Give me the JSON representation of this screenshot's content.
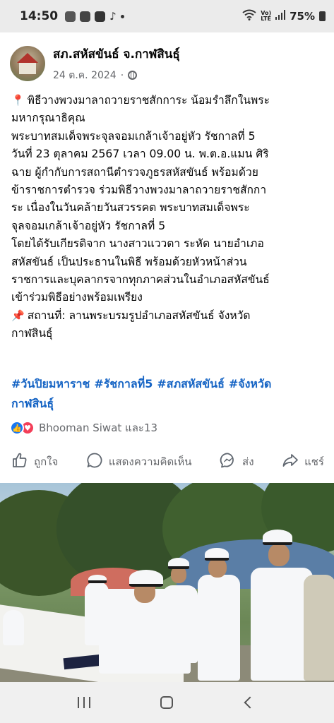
{
  "status_bar": {
    "time": "14:50",
    "left_icons": [
      "line-icon",
      "messages-icon",
      "checkbox-icon",
      "tiktok-icon",
      "dot-icon"
    ],
    "right_icons": [
      "wifi-icon",
      "volte-icon",
      "signal-icon",
      "battery-icon"
    ],
    "battery": "75%"
  },
  "post": {
    "author": "สภ.สหัสขันธ์ จ.กาฬสินธุ์",
    "date": "24 ต.ค. 2024",
    "dot": "·",
    "privacy_icon": "globe-icon",
    "lines": [
      "พิธีวางพวงมาลาถวายราชสักการะ น้อมรำลึกในพระ",
      "มหากรุณาธิคุณ",
      "พระบาทสมเด็จพระจุลจอมเกล้าเจ้าอยู่หัว รัชกาลที่ 5",
      "วันที่ 23 ตุลาคม 2567 เวลา 09.00 น. พ.ต.อ.แมน ศิริ",
      "ฉาย ผู้กำกับการสถานีตำรวจภูธรสหัสขันธ์ พร้อมด้วย",
      "ข้าราชการตำรวจ ร่วมพิธีวางพวงมาลาถวายราชสักกา",
      "ระ เนื่องในวันคล้ายวันสวรรคต พระบาทสมเด็จพระ",
      "จุลจอมเกล้าเจ้าอยู่หัว รัชกาลที่ 5",
      "โดยได้รับเกียรติจาก นางสาวแววตา ระหัด นายอำเภอ",
      "สหัสขันธ์ เป็นประธานในพิธี พร้อมด้วยหัวหน้าส่วน",
      "ราชการและบุคลากรจากทุกภาคส่วนในอำเภอสหัสขันธ์",
      "เข้าร่วมพิธีอย่างพร้อมเพรียง",
      "สถานที่: ลานพระบรมรูปอำเภอสหัสขันธ์ จังหวัด",
      "กาฬสินธุ์"
    ],
    "first_line_emoji": "📍",
    "location_emoji": "📌",
    "hashtags": [
      "#วันปิยมหาราช",
      "#รัชกาลที่5",
      "#สภสหัสขันธ์",
      "#จังหวัด",
      "กาฬสินธุ์"
    ],
    "reactions_text": "Bhooman Siwat และ13",
    "actions": {
      "like": "ถูกใจ",
      "comment": "แสดงความคิดเห็น",
      "send": "ส่ง",
      "share": "แชร์"
    }
  },
  "nav": {
    "items": [
      "recent-apps-button",
      "home-button",
      "back-button"
    ]
  }
}
